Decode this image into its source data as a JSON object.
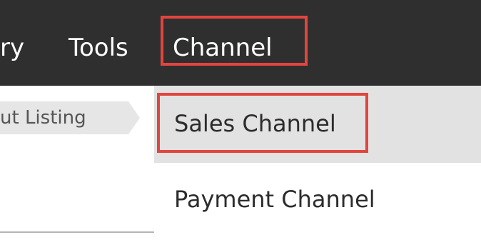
{
  "topbar": {
    "items": [
      {
        "label": "ry"
      },
      {
        "label": "Tools"
      },
      {
        "label": "Channel"
      }
    ]
  },
  "breadcrumb": {
    "label": "ut Listing"
  },
  "dropdown": {
    "items": [
      {
        "label": "Sales Channel"
      },
      {
        "label": "Payment Channel"
      }
    ]
  },
  "colors": {
    "topbar_bg": "#2f2f2f",
    "highlight": "#e2453e",
    "hover_bg": "#e2e2e2"
  }
}
